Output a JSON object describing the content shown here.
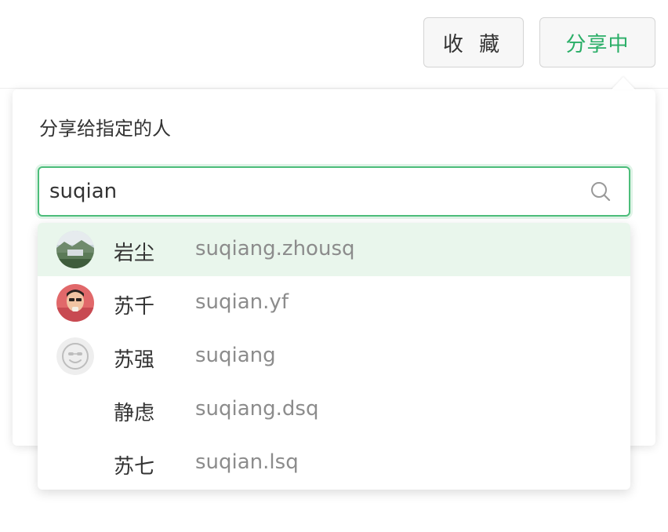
{
  "toolbar": {
    "favorite_label": "收 藏",
    "share_label": "分享中"
  },
  "share_panel": {
    "title": "分享给指定的人",
    "search": {
      "value": "suqian",
      "icon": "search-icon"
    }
  },
  "suggestions": [
    {
      "name": "岩尘",
      "account": "suqiang.zhousq",
      "avatar": "landscape-photo"
    },
    {
      "name": "苏千",
      "account": "suqian.yf",
      "avatar": "person-photo"
    },
    {
      "name": "苏强",
      "account": "suqiang",
      "avatar": "default-smiley-avatar"
    },
    {
      "name": "静虑",
      "account": "suqiang.dsq",
      "avatar": "none"
    },
    {
      "name": "苏七",
      "account": "suqian.lsq",
      "avatar": "none"
    }
  ],
  "colors": {
    "accent": "#2aae67",
    "focus_border": "#4cbd7a",
    "highlight_row": "#e9f6ec",
    "secondary_text": "#8c8c8c"
  }
}
